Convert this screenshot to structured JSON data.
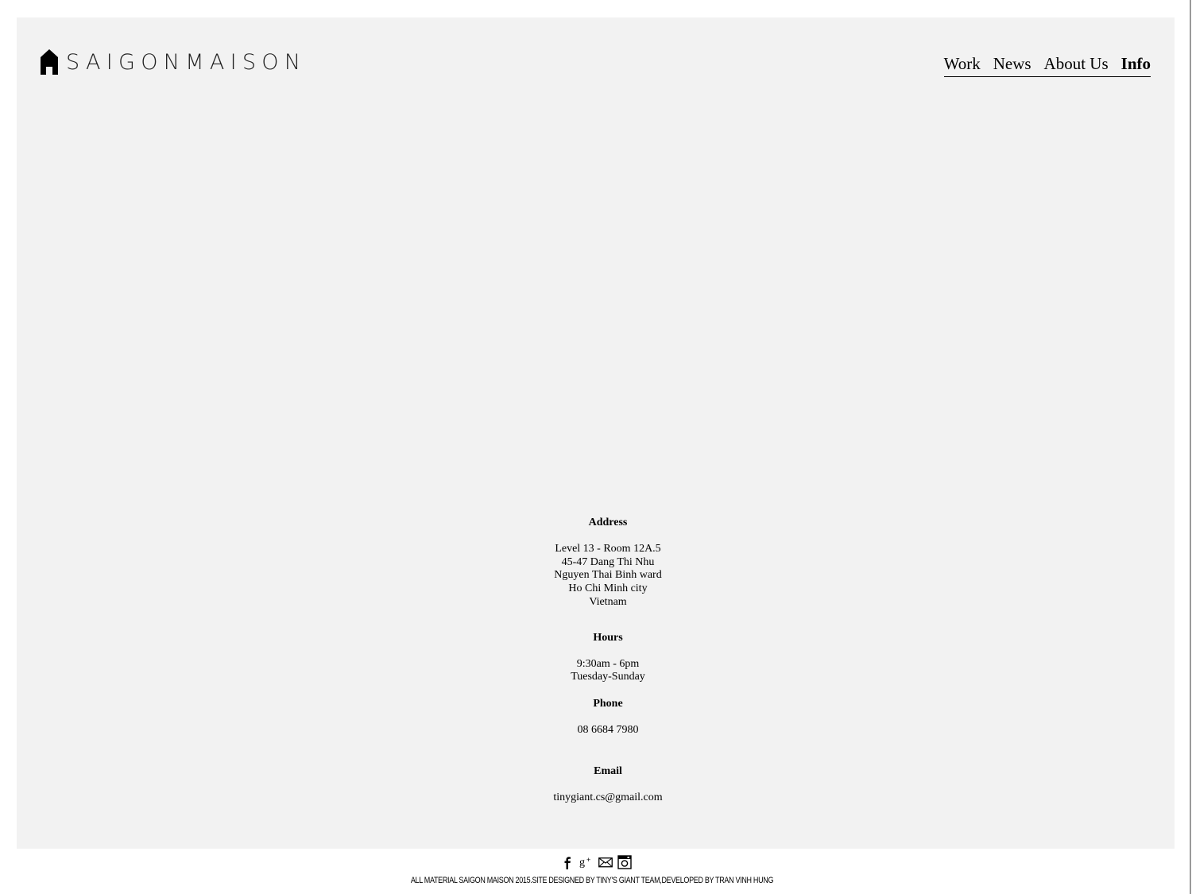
{
  "brand": {
    "name": "SAIGONMAISON",
    "logo_icon": "house-icon"
  },
  "nav": {
    "items": [
      {
        "label": "Work",
        "active": false
      },
      {
        "label": "News",
        "active": false
      },
      {
        "label": "About Us",
        "active": false
      },
      {
        "label": "Info",
        "active": true
      }
    ]
  },
  "info": {
    "address": {
      "heading": "Address",
      "lines": [
        "Level 13 - Room 12A.5",
        "45-47 Dang Thi Nhu",
        "Nguyen Thai Binh ward",
        "Ho Chi Minh city",
        "Vietnam"
      ]
    },
    "hours": {
      "heading": "Hours",
      "lines": [
        "9:30am - 6pm",
        "Tuesday-Sunday"
      ]
    },
    "phone": {
      "heading": "Phone",
      "value": "08 6684 7980"
    },
    "email": {
      "heading": "Email",
      "value": "tinygiant.cs@gmail.com"
    }
  },
  "footer": {
    "social_icons": [
      "facebook-icon",
      "google-plus-icon",
      "mail-icon",
      "instagram-icon"
    ],
    "copyright": "ALL MATERIAL SAIGON MAISON 2015.SITE DESIGNED BY TINY'S GIANT TEAM,DEVELOPED BY TRAN VINH HUNG"
  },
  "colors": {
    "page_background": "#ffffff",
    "panel_background": "#f2f2f2",
    "text": "#000000"
  }
}
